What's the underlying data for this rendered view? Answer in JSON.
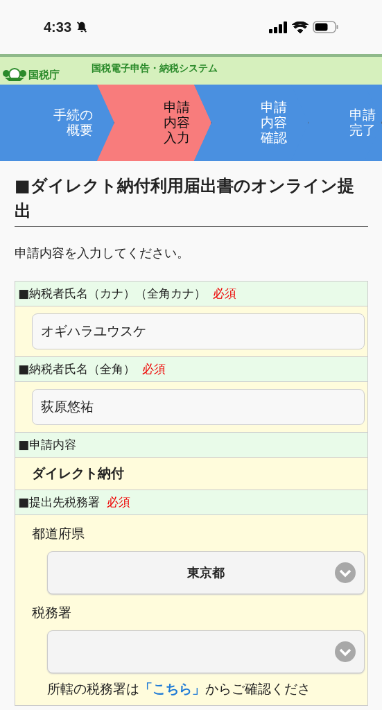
{
  "status_bar": {
    "time": "4:33"
  },
  "header": {
    "agency": "国税庁",
    "system": "国税電子申告・納税システム"
  },
  "steps": [
    {
      "label": "手続の概要",
      "selected": false
    },
    {
      "label": "申請内容入力",
      "selected": true
    },
    {
      "label": "申請内容確認",
      "selected": false
    },
    {
      "label": "申請完了",
      "selected": false
    }
  ],
  "title": "■ダイレクト納付利用届出書のオンライン提出",
  "intro": "申請内容を入力してください。",
  "sections": [
    {
      "label": "■納税者氏名（カナ）（全角カナ）",
      "required": "必須",
      "kind": "input",
      "value": "オギハラユウスケ"
    },
    {
      "label": "■納税者氏名（全角）",
      "required": "必須",
      "kind": "input",
      "value": "荻原悠祐"
    },
    {
      "label": "■申請内容",
      "kind": "text",
      "value": "ダイレクト納付"
    },
    {
      "label": "■提出先税務署",
      "required": "必須",
      "kind": "selects",
      "fields": [
        {
          "label": "都道府県",
          "value": "東京都"
        },
        {
          "label": "税務署"
        }
      ],
      "note": {
        "before": "所轄の税務署は",
        "link": "「こちら」",
        "after": "からご確認くださ"
      }
    }
  ]
}
